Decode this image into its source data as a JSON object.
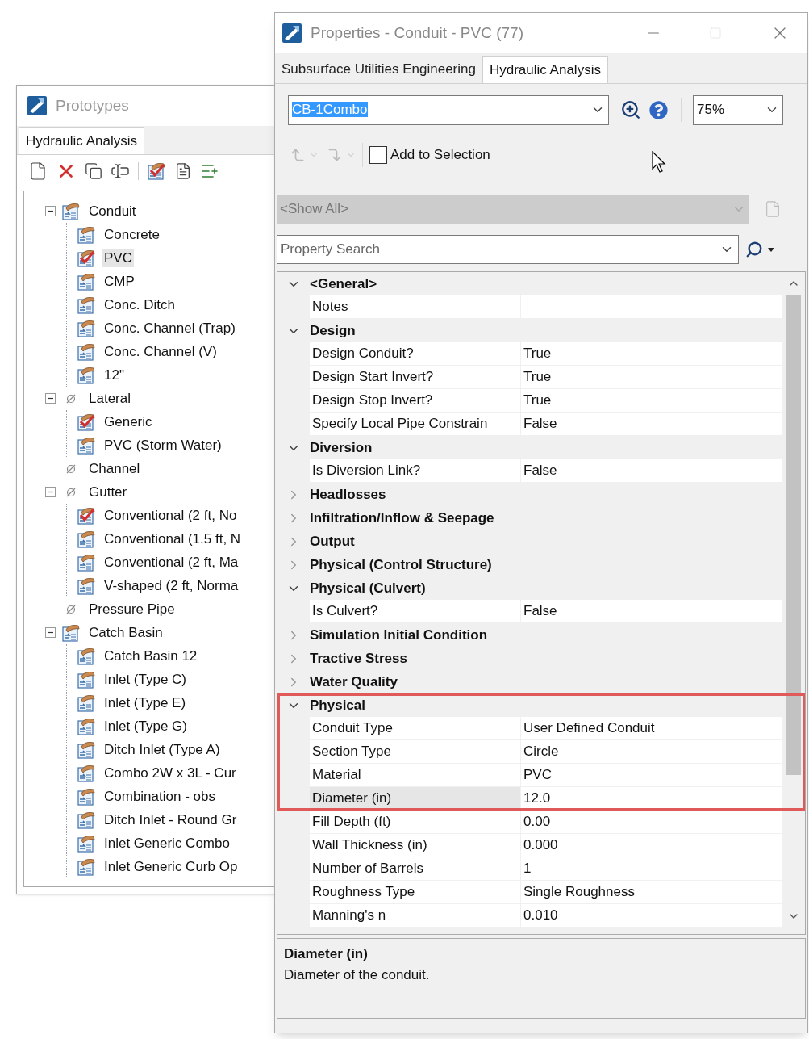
{
  "prototypes": {
    "title": "Prototypes",
    "tabs": [
      {
        "label": "Hydraulic Analysis",
        "selected": true
      }
    ],
    "tree": [
      {
        "label": "Conduit",
        "kind": "prototype",
        "expanded": true,
        "selected": false,
        "children": [
          {
            "label": "Concrete",
            "kind": "prototype",
            "selected": false
          },
          {
            "label": "PVC",
            "kind": "default",
            "selected": true
          },
          {
            "label": "CMP",
            "kind": "prototype",
            "selected": false
          },
          {
            "label": "Conc. Ditch",
            "kind": "prototype",
            "selected": false
          },
          {
            "label": "Conc. Channel (Trap)",
            "kind": "prototype",
            "selected": false
          },
          {
            "label": "Conc. Channel (V)",
            "kind": "prototype",
            "selected": false
          },
          {
            "label": "12\"",
            "kind": "prototype",
            "selected": false
          }
        ]
      },
      {
        "label": "Lateral",
        "kind": "category",
        "expanded": true,
        "selected": false,
        "children": [
          {
            "label": "Generic",
            "kind": "default",
            "selected": false
          },
          {
            "label": "PVC (Storm Water)",
            "kind": "prototype",
            "selected": false
          }
        ]
      },
      {
        "label": "Channel",
        "kind": "category",
        "selected": false
      },
      {
        "label": "Gutter",
        "kind": "category",
        "expanded": true,
        "selected": false,
        "children": [
          {
            "label": "Conventional (2 ft, No",
            "kind": "default",
            "selected": false
          },
          {
            "label": "Conventional (1.5 ft, N",
            "kind": "prototype",
            "selected": false
          },
          {
            "label": "Conventional (2 ft, Ma",
            "kind": "prototype",
            "selected": false
          },
          {
            "label": "V-shaped (2 ft, Norma",
            "kind": "prototype",
            "selected": false
          }
        ]
      },
      {
        "label": "Pressure Pipe",
        "kind": "category",
        "selected": false
      },
      {
        "label": "Catch Basin",
        "kind": "prototype",
        "expanded": true,
        "selected": false,
        "children": [
          {
            "label": "Catch Basin 12",
            "kind": "prototype",
            "selected": false
          },
          {
            "label": "Inlet (Type C)",
            "kind": "prototype",
            "selected": false
          },
          {
            "label": "Inlet (Type E)",
            "kind": "prototype",
            "selected": false
          },
          {
            "label": "Inlet (Type G)",
            "kind": "prototype",
            "selected": false
          },
          {
            "label": "Ditch Inlet (Type A)",
            "kind": "prototype",
            "selected": false
          },
          {
            "label": "Combo 2W x 3L - Cur",
            "kind": "prototype",
            "selected": false
          },
          {
            "label": "Combination - obs",
            "kind": "prototype",
            "selected": false
          },
          {
            "label": "Ditch Inlet - Round Gr",
            "kind": "prototype",
            "selected": false
          },
          {
            "label": "Inlet Generic Combo",
            "kind": "prototype",
            "selected": false
          },
          {
            "label": "Inlet Generic Curb Op",
            "kind": "prototype",
            "selected": false
          }
        ]
      }
    ]
  },
  "properties": {
    "title": "Properties - Conduit - PVC (77)",
    "tabs": [
      {
        "label": "Subsurface Utilities Engineering",
        "selected": false
      },
      {
        "label": "Hydraulic Analysis",
        "selected": true
      }
    ],
    "element_combo": {
      "value": "CB-1Combo",
      "text_selected": true
    },
    "zoom_combo": {
      "value": "75%"
    },
    "add_to_selection": {
      "label": "Add to Selection",
      "checked": false
    },
    "filter_combo": {
      "value": "<Show All>",
      "disabled": true
    },
    "search": {
      "placeholder": "Property Search"
    },
    "rows": [
      {
        "kind": "group",
        "label": "<General>",
        "expanded": true,
        "highlighted": false
      },
      {
        "kind": "property",
        "name": "Notes",
        "selected": false,
        "highlighted": false
      },
      {
        "kind": "group",
        "label": "Design",
        "expanded": true,
        "highlighted": false
      },
      {
        "kind": "property",
        "name": "Design Conduit?",
        "value": "True",
        "selected": false,
        "highlighted": false
      },
      {
        "kind": "property",
        "name": "Design Start Invert?",
        "value": "True",
        "selected": false,
        "highlighted": false
      },
      {
        "kind": "property",
        "name": "Design Stop Invert?",
        "value": "True",
        "selected": false,
        "highlighted": false
      },
      {
        "kind": "property",
        "name": "Specify Local Pipe Constrain",
        "value": "False",
        "selected": false,
        "highlighted": false
      },
      {
        "kind": "group",
        "label": "Diversion",
        "expanded": true,
        "highlighted": false
      },
      {
        "kind": "property",
        "name": "Is Diversion Link?",
        "value": "False",
        "selected": false,
        "highlighted": false
      },
      {
        "kind": "group",
        "label": "Headlosses",
        "expanded": false,
        "highlighted": false
      },
      {
        "kind": "group",
        "label": "Infiltration/Inflow & Seepage",
        "expanded": false,
        "highlighted": false
      },
      {
        "kind": "group",
        "label": "Output",
        "expanded": false,
        "highlighted": false
      },
      {
        "kind": "group",
        "label": "Physical (Control Structure)",
        "expanded": false,
        "highlighted": false
      },
      {
        "kind": "group",
        "label": "Physical (Culvert)",
        "expanded": true,
        "highlighted": false
      },
      {
        "kind": "property",
        "name": "Is Culvert?",
        "value": "False",
        "selected": false,
        "highlighted": false
      },
      {
        "kind": "group",
        "label": "Simulation Initial Condition",
        "expanded": false,
        "highlighted": false
      },
      {
        "kind": "group",
        "label": "Tractive Stress",
        "expanded": false,
        "highlighted": false
      },
      {
        "kind": "group",
        "label": "Water Quality",
        "expanded": false,
        "highlighted": false
      },
      {
        "kind": "group",
        "label": "Physical",
        "expanded": true,
        "highlighted": true
      },
      {
        "kind": "property",
        "name": "Conduit Type",
        "value": "User Defined Conduit",
        "selected": false,
        "highlighted": true
      },
      {
        "kind": "property",
        "name": "Section Type",
        "value": "Circle",
        "selected": false,
        "highlighted": true
      },
      {
        "kind": "property",
        "name": "Material",
        "value": "PVC",
        "selected": false,
        "highlighted": true
      },
      {
        "kind": "property",
        "name": "Diameter (in)",
        "value": "12.0",
        "selected": true,
        "highlighted": true
      },
      {
        "kind": "property",
        "name": "Fill Depth (ft)",
        "value": "0.00",
        "selected": false,
        "highlighted": false
      },
      {
        "kind": "property",
        "name": "Wall Thickness (in)",
        "value": "0.000",
        "selected": false,
        "highlighted": false
      },
      {
        "kind": "property",
        "name": "Number of Barrels",
        "value": "1",
        "selected": false,
        "highlighted": false
      },
      {
        "kind": "property",
        "name": "Roughness Type",
        "value": "Single Roughness",
        "selected": false,
        "highlighted": false
      },
      {
        "kind": "property",
        "name": "Manning's n",
        "value": "0.010",
        "selected": false,
        "highlighted": false
      }
    ],
    "description": {
      "title": "Diameter (in)",
      "text": "Diameter of the conduit."
    }
  }
}
